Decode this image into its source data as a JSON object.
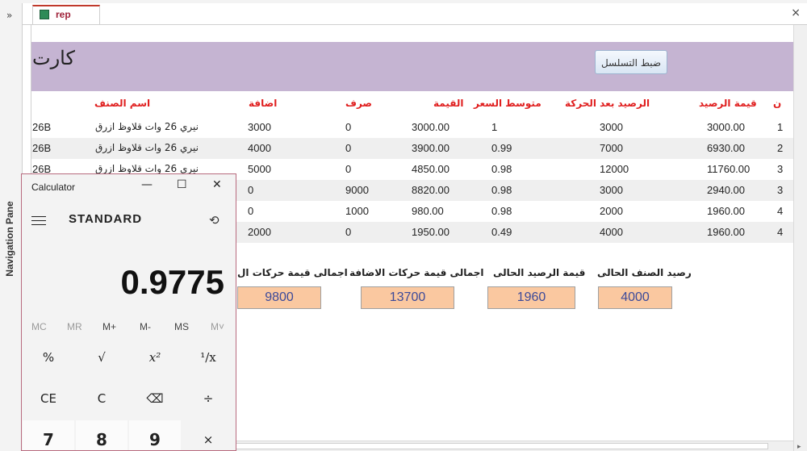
{
  "tab": {
    "label": "rep",
    "close": "×"
  },
  "nav_pane": {
    "chevron": "»",
    "label": "Navigation Pane"
  },
  "form": {
    "title": "كارت",
    "sequence_button": "ضبط التسلسل",
    "columns": [
      "اسم الصنف",
      "اضافة",
      "صرف",
      "القيمة",
      "متوسط السعر",
      "الرصيد بعد الحركة",
      "قيمة الرصيد",
      "ن"
    ],
    "rows": [
      {
        "code": "26B",
        "name": "نيري 26 وات قلاوظ ازرق",
        "add": "3000",
        "out": "0",
        "value": "3000.00",
        "avg": "1",
        "balance": "3000",
        "bal_value": "3000.00",
        "n": "1"
      },
      {
        "code": "26B",
        "name": "نيري 26 وات قلاوظ ازرق",
        "add": "4000",
        "out": "0",
        "value": "3900.00",
        "avg": "0.99",
        "balance": "7000",
        "bal_value": "6930.00",
        "n": "2"
      },
      {
        "code": "26B",
        "name": "نيري 26 وات قلاوظ ازرق",
        "add": "5000",
        "out": "0",
        "value": "4850.00",
        "avg": "0.98",
        "balance": "12000",
        "bal_value": "11760.00",
        "n": "3"
      },
      {
        "code": "",
        "name": "",
        "add": "0",
        "out": "9000",
        "value": "8820.00",
        "avg": "0.98",
        "balance": "3000",
        "bal_value": "2940.00",
        "n": "3"
      },
      {
        "code": "",
        "name": "",
        "add": "0",
        "out": "1000",
        "value": "980.00",
        "avg": "0.98",
        "balance": "2000",
        "bal_value": "1960.00",
        "n": "4"
      },
      {
        "code": "",
        "name": "",
        "add": "2000",
        "out": "0",
        "value": "1950.00",
        "avg": "0.49",
        "balance": "4000",
        "bal_value": "1960.00",
        "n": "4"
      }
    ],
    "summary": [
      {
        "label": "اجمالى قيمة حركات ال",
        "value": "9800"
      },
      {
        "label": "اجمالى قيمة حركات الاضافة",
        "value": "13700"
      },
      {
        "label": "قيمة الرصيد الحالى",
        "value": "1960"
      },
      {
        "label": "رصيد الصنف الحالى",
        "value": "4000"
      }
    ]
  },
  "calculator": {
    "title": "Calculator",
    "minimize": "—",
    "maximize": "☐",
    "close": "✕",
    "mode": "STANDARD",
    "display": "0.9775",
    "memory": [
      "MC",
      "MR",
      "M+",
      "M-",
      "MS",
      "M˅"
    ],
    "keys": {
      "row1": [
        "%",
        "√",
        "x²",
        "¹/x"
      ],
      "row2": [
        "CE",
        "C",
        "⌫",
        "÷"
      ],
      "row3": [
        "7",
        "8",
        "9",
        "×"
      ]
    }
  },
  "colors": {
    "header_band": "#c5b4d2",
    "column_header": "#e02020",
    "summary_box": "#fac8a0",
    "summary_text": "#3c4a9a",
    "calc_border": "#b86a7e"
  }
}
